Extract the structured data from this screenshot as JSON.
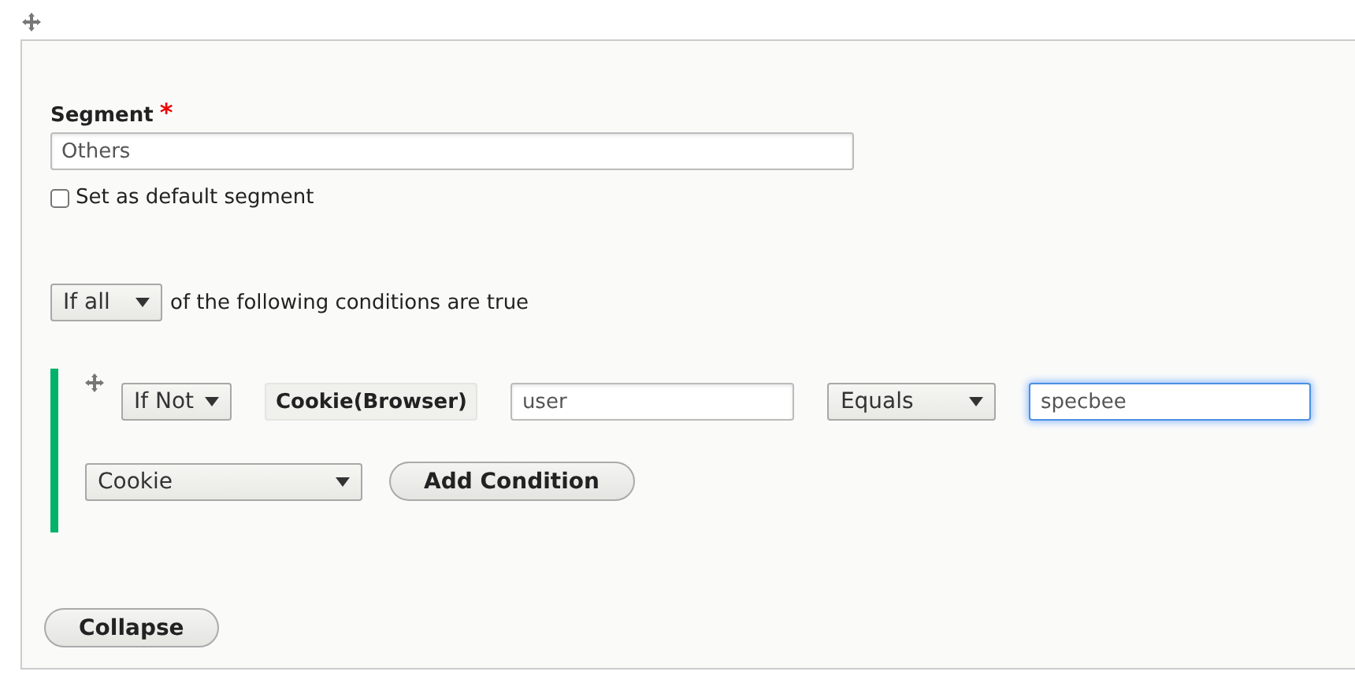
{
  "segment": {
    "label": "Segment",
    "required_mark": "*",
    "value": "Others"
  },
  "default_checkbox": {
    "label": "Set as default segment",
    "checked": false
  },
  "match": {
    "select": "If all",
    "text": "of the following conditions are true"
  },
  "conditions": [
    {
      "negation": "If Not",
      "type": "Cookie(Browser)",
      "name": "user",
      "operator": "Equals",
      "value": "specbee",
      "focused": true
    }
  ],
  "add": {
    "select": "Cookie",
    "button": "Add Condition"
  },
  "collapse_button": "Collapse"
}
